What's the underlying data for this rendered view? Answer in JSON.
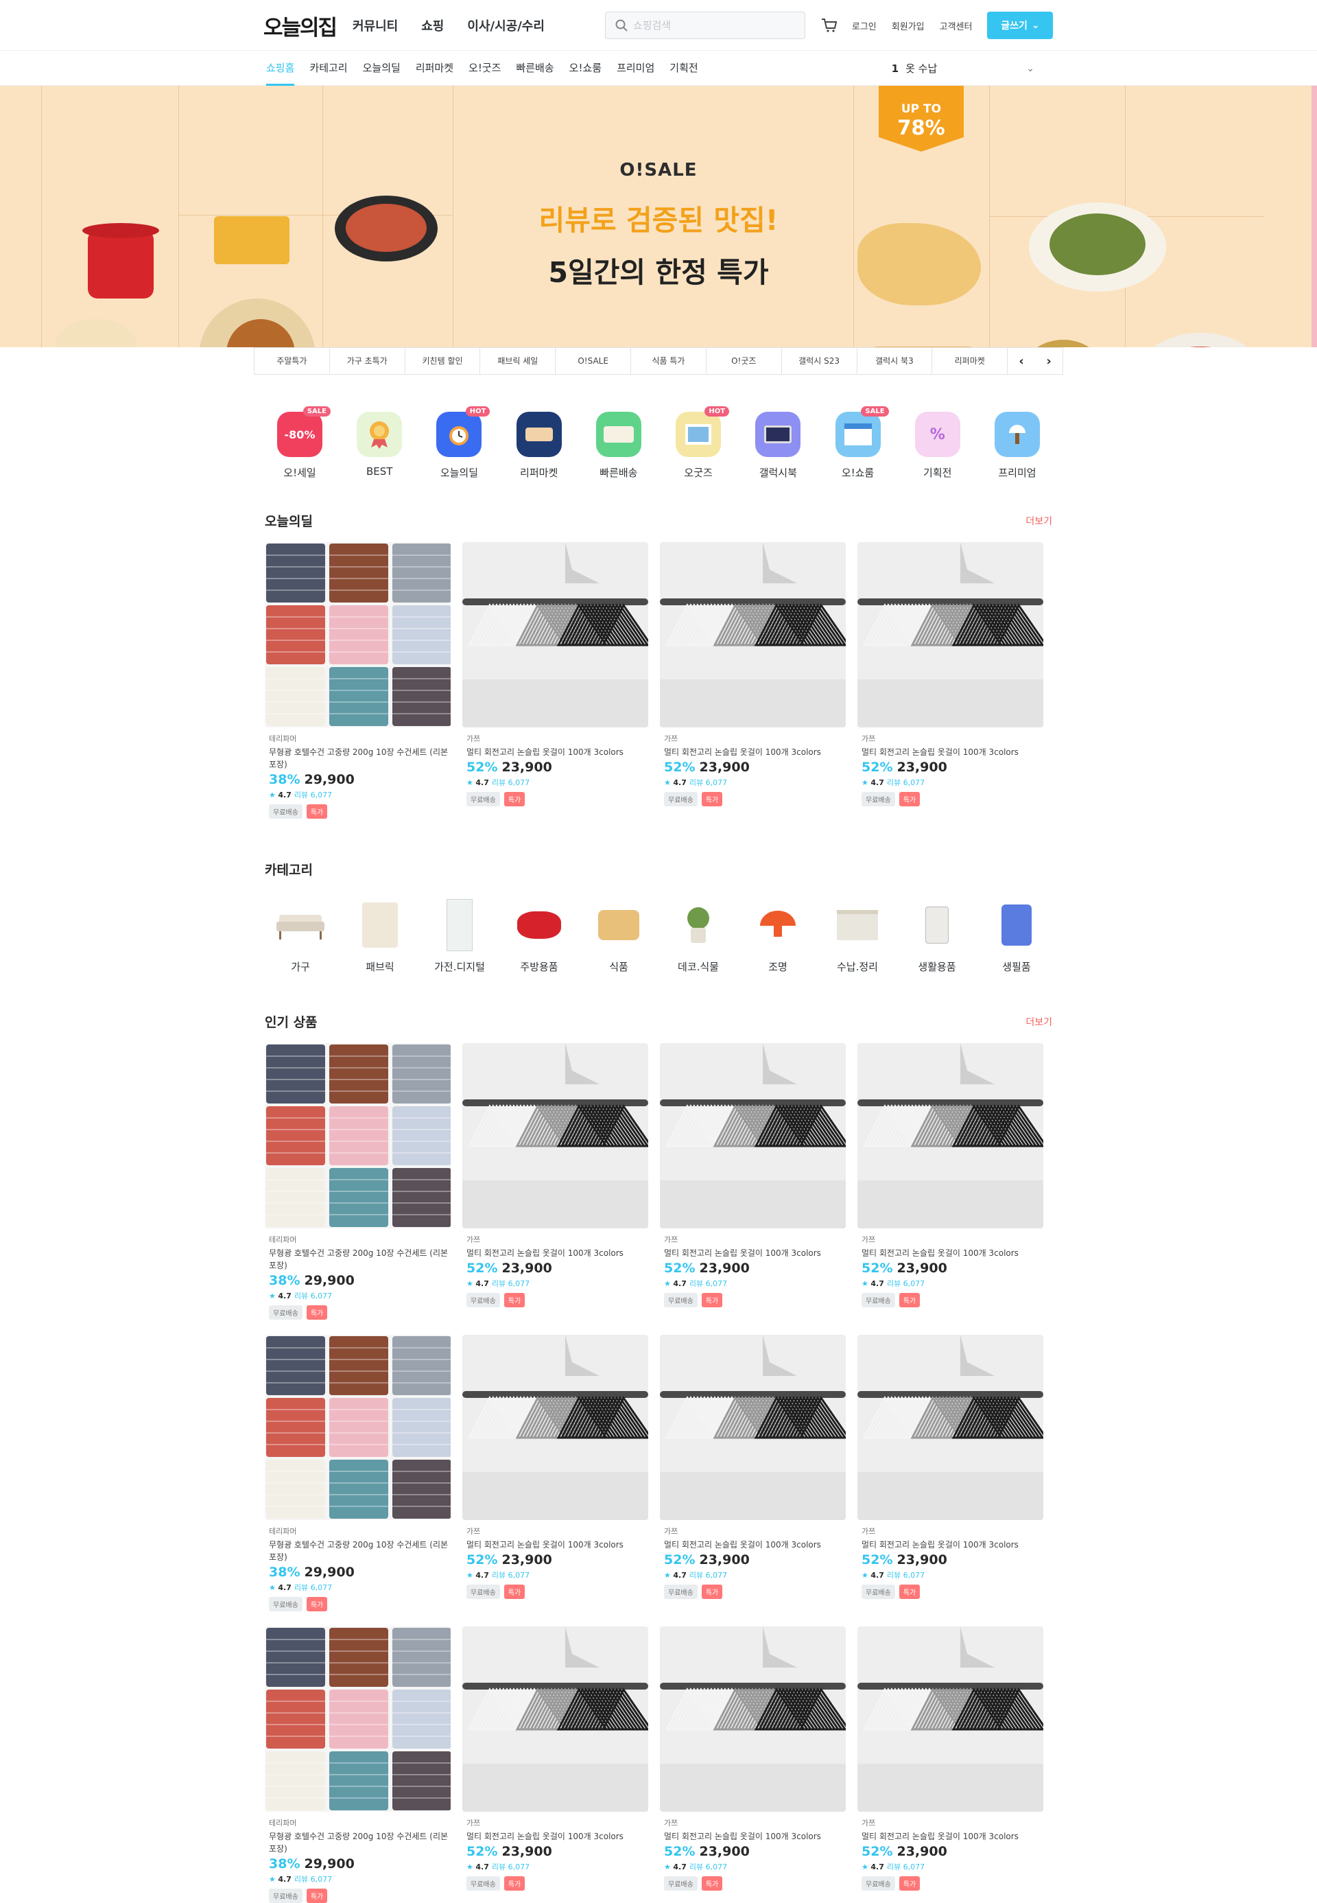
{
  "header": {
    "logo": "오늘의집",
    "gnb": [
      "커뮤니티",
      "쇼핑",
      "이사/시공/수리"
    ],
    "search_placeholder": "쇼핑검색",
    "util": [
      "로그인",
      "회원가입",
      "고객센터"
    ],
    "write_label": "글쓰기"
  },
  "subnav": {
    "items": [
      "쇼핑홈",
      "카테고리",
      "오늘의딜",
      "리퍼마켓",
      "오!굿즈",
      "빠른배송",
      "오!쇼룸",
      "프리미엄",
      "기획전"
    ],
    "rank_num": "1",
    "rank_text": "옷 수납"
  },
  "banner": {
    "brand": "O!SALE",
    "line1": "리뷰로 검증된 맛집!",
    "line2": "5일간의 한정 특가",
    "upto_a": "UP TO",
    "upto_b": "78%",
    "colors": {
      "bg": "#fbe3c2",
      "accent": "#f3a11b"
    }
  },
  "tabs": [
    "주말특가",
    "가구 초특가",
    "키친템 할인",
    "패브릭 세일",
    "O!SALE",
    "식품 특가",
    "O!굿즈",
    "갤럭시 S23",
    "갤럭시 북3",
    "리퍼마켓"
  ],
  "quick": [
    {
      "label": "오!세일",
      "badge": "SALE",
      "icon": "sale-icon",
      "color": "#f0405e"
    },
    {
      "label": "BEST",
      "badge": "",
      "icon": "best-medal-icon",
      "color": "#e7f5d6"
    },
    {
      "label": "오늘의딜",
      "badge": "HOT",
      "icon": "alarm-clock-icon",
      "color": "#3a6cf2"
    },
    {
      "label": "리퍼마켓",
      "badge": "",
      "icon": "refurb-icon",
      "color": "#1f3b73"
    },
    {
      "label": "빠른배송",
      "badge": "",
      "icon": "bed-icon",
      "color": "#5fd38a"
    },
    {
      "label": "오굿즈",
      "badge": "HOT",
      "icon": "frame-icon",
      "color": "#f5e6a3"
    },
    {
      "label": "갤럭시북",
      "badge": "",
      "icon": "laptop-icon",
      "color": "#8d8ff2"
    },
    {
      "label": "오!쇼룸",
      "badge": "SALE",
      "icon": "store-icon",
      "color": "#7cc7f4"
    },
    {
      "label": "기획전",
      "badge": "",
      "icon": "percent-tag-icon",
      "color": "#f2a9e6"
    },
    {
      "label": "프리미엄",
      "badge": "",
      "icon": "lamp-icon",
      "color": "#7dc5f7"
    }
  ],
  "today_deal": {
    "title": "오늘의딜",
    "more": "더보기"
  },
  "category": {
    "title": "카테고리",
    "items": [
      "가구",
      "패브릭",
      "가전.디지털",
      "주방용품",
      "식품",
      "데코.식물",
      "조명",
      "수납.정리",
      "생활용품",
      "생필품"
    ]
  },
  "popular": {
    "title": "인기 상품",
    "more": "더보기"
  },
  "products": {
    "towel": {
      "brand": "테리파머",
      "name": "무형광 호텔수건 고중량 200g 10장 수건세트 (리본포장)",
      "pct": "38%",
      "price": "29,900",
      "rating": "4.7",
      "reviews": "리뷰 6,077",
      "free": "무료배송",
      "deal": "특가"
    },
    "hanger": {
      "brand": "가쯔",
      "name": "멀티 회전고리 논슬립 옷걸이 100개 3colors",
      "pct": "52%",
      "price": "23,900",
      "rating": "4.7",
      "reviews": "리뷰 6,077",
      "free": "무료배송",
      "deal": "특가"
    }
  }
}
